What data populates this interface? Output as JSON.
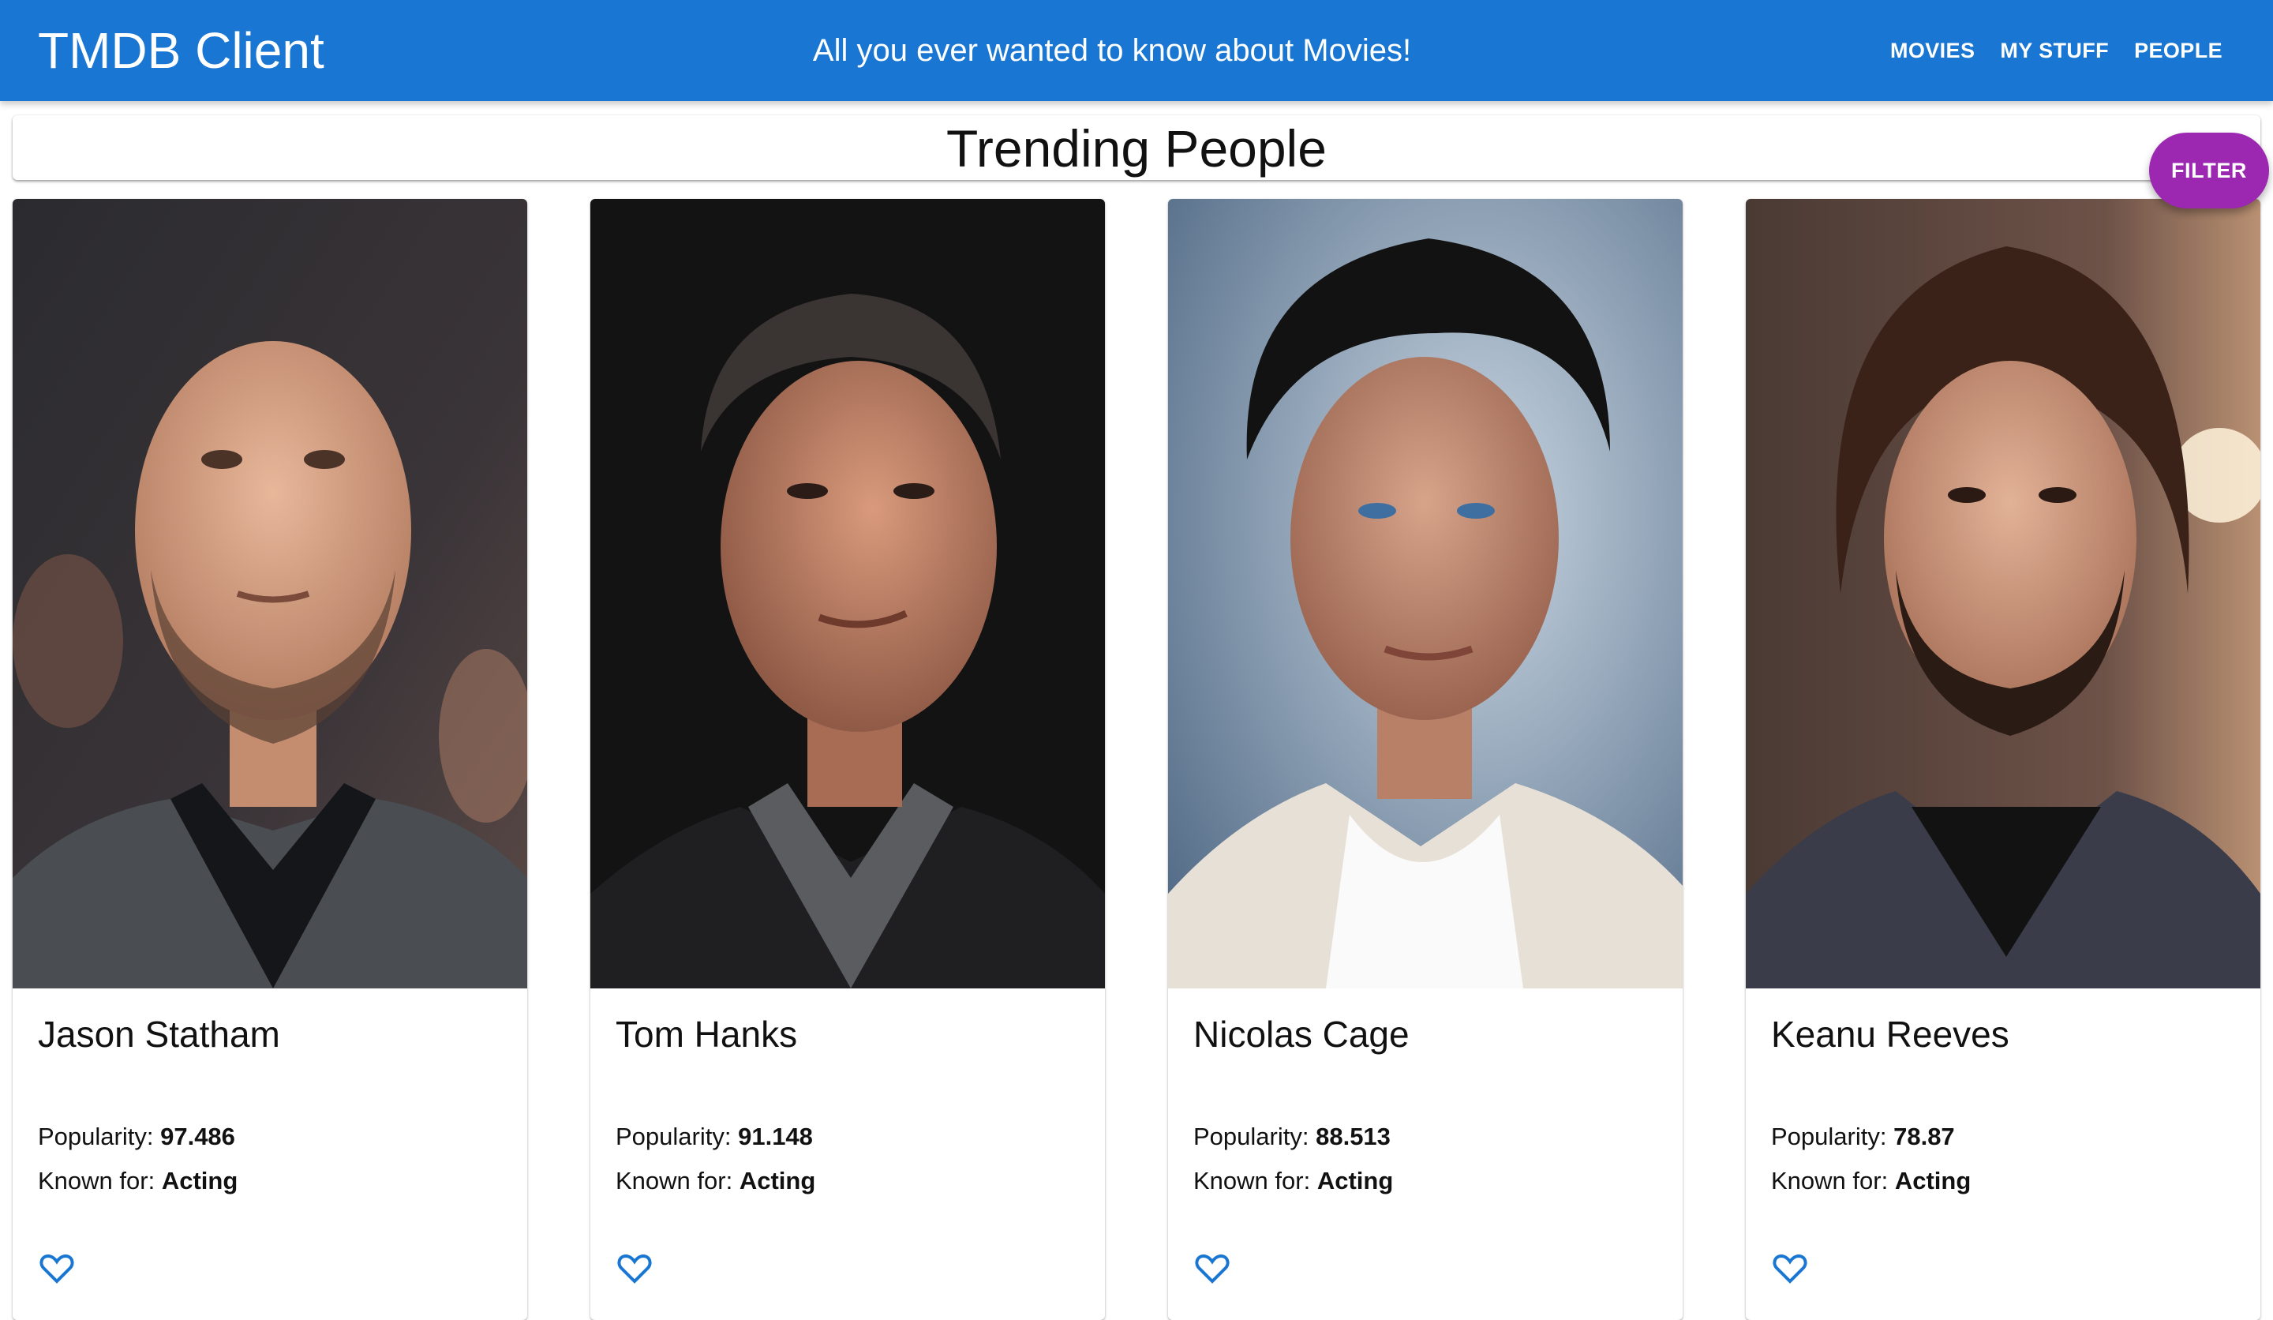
{
  "app": {
    "title": "TMDB Client",
    "tagline": "All you ever wanted to know about Movies!"
  },
  "nav": {
    "items": [
      "MOVIES",
      "MY STUFF",
      "PEOPLE"
    ]
  },
  "page": {
    "title": "Trending People",
    "filter_label": "FILTER"
  },
  "labels": {
    "popularity": "Popularity:",
    "known_for": "Known for:"
  },
  "people": [
    {
      "name": "Jason Statham",
      "popularity": "97.486",
      "known_for": "Acting"
    },
    {
      "name": "Tom Hanks",
      "popularity": "91.148",
      "known_for": "Acting"
    },
    {
      "name": "Nicolas Cage",
      "popularity": "88.513",
      "known_for": "Acting"
    },
    {
      "name": "Keanu Reeves",
      "popularity": "78.87",
      "known_for": "Acting"
    }
  ],
  "colors": {
    "appbar": "#1976d2",
    "filter": "#9c27b0",
    "favorite_icon": "#1976d2"
  },
  "icons": {
    "favorite": "heart-outline-icon"
  }
}
